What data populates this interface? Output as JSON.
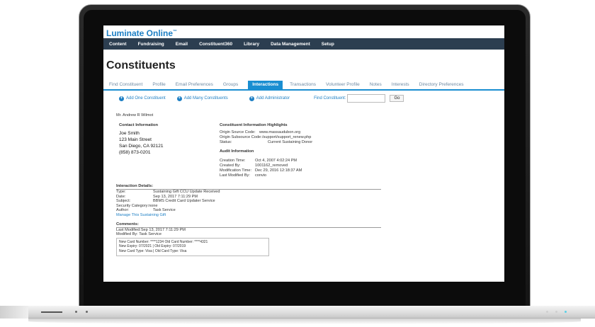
{
  "brand": {
    "name": "Luminate Online",
    "mark": "™"
  },
  "nav": [
    "Content",
    "Fundraising",
    "Email",
    "Constituent360",
    "Library",
    "Data Management",
    "Setup"
  ],
  "page_title": "Constituents",
  "tabs": [
    {
      "label": "Find Constituent",
      "active": false
    },
    {
      "label": "Profile",
      "active": false
    },
    {
      "label": "Email Preferences",
      "active": false
    },
    {
      "label": "Groups",
      "active": false
    },
    {
      "label": "Interactions",
      "active": true
    },
    {
      "label": "Transactions",
      "active": false
    },
    {
      "label": "Volunteer Profile",
      "active": false
    },
    {
      "label": "Notes",
      "active": false
    },
    {
      "label": "Interests",
      "active": false
    },
    {
      "label": "Directory Preferences",
      "active": false
    }
  ],
  "actions": {
    "add_one": "Add One Constituent",
    "add_many": "Add Many Constituents",
    "add_admin": "Add Administrator",
    "find_label": "Find Constituent:",
    "find_value": "",
    "go": "Go"
  },
  "constituent": {
    "name": "Mr. Andrew R Wilmot",
    "contact_title": "Contact Information",
    "contact_lines": [
      "Joe Smith",
      "123 Main Street",
      "San Diego, CA 92121",
      "(858) 873-0201"
    ],
    "highlights_title": "Constituent Information Highlights",
    "highlights": [
      {
        "k": "Origin Source Code:",
        "v": "www.massaudubon.org"
      },
      {
        "k": "Origin Subsource Code:",
        "v": "/support/support_renew.php"
      },
      {
        "k": "Status:",
        "v": "Current Sustaining Donor"
      }
    ],
    "audit_title": "Audit Information",
    "audit": [
      {
        "k": "Creation Time:",
        "v": "Oct 4, 2007 4:02:24 PM"
      },
      {
        "k": "Created By:",
        "v": "1001162_removed"
      },
      {
        "k": "Modification Time:",
        "v": "Dec 29, 2016 12:18:37 AM"
      },
      {
        "k": "Last Modified By:",
        "v": "convio"
      }
    ]
  },
  "interaction": {
    "title": "Interaction Details:",
    "rows": [
      {
        "k": "Type:",
        "v": "Sustaining Gift CCU Update Received"
      },
      {
        "k": "Date:",
        "v": "Sep 13, 2017 7:11:29 PM"
      },
      {
        "k": "Subject:",
        "v": "BBMS Credit Card Updater Service"
      },
      {
        "k": "Security Category:",
        "v": "none"
      },
      {
        "k": "Author:",
        "v": "Task Service"
      }
    ],
    "manage_link": "Manage This Sustaining Gift"
  },
  "comments": {
    "title": "Comments:",
    "last_modified": "Last Modified:Sep 13, 2017 7:11:29 PM",
    "modified_by": "Modified By:  Task Service",
    "box_lines": [
      "New Card Number:  ****1234    Old Card Number:  ****4321",
      "New Expiry:     07/2021  |  Old Expiry:      07/2019",
      "New Card Type:      Visa  |  Old Card Type:      Visa"
    ]
  }
}
